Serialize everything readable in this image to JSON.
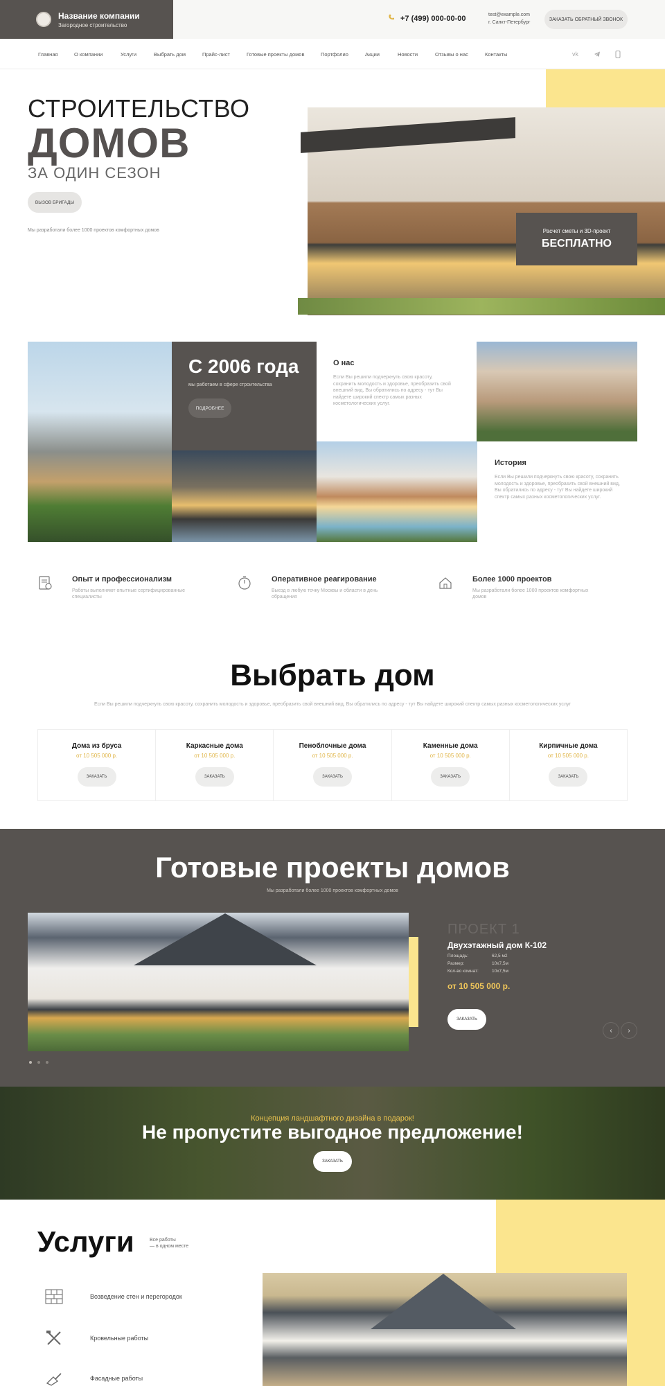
{
  "header": {
    "company_name": "Название компании",
    "company_sub": "Загородное строительство",
    "phone": "+7 (499) 000-00-00",
    "email": "test@example.com",
    "city": "г. Санкт-Петербург",
    "callback": "ЗАКАЗАТЬ ОБРАТНЫЙ ЗВОНОК"
  },
  "nav": {
    "items": [
      "Главная",
      "О компании",
      "Услуги",
      "Выбрать дом",
      "Прайс-лист",
      "Готовые проекты домов",
      "Портфолио",
      "Акции",
      "Новости",
      "Отзывы о нас",
      "Контакты"
    ],
    "social": [
      "vk-icon",
      "telegram-icon",
      "whatsapp-icon"
    ]
  },
  "hero": {
    "title1": "СТРОИТЕЛЬСТВО",
    "title2": "ДОМОВ",
    "title3": "ЗА ОДИН СЕЗОН",
    "button": "ВЫЗОВ БРИГАДЫ",
    "subtitle": "Мы разработали более 1000 проектов комфортных домов",
    "promo_line1": "Расчет сметы и 3D-проект",
    "promo_line2": "БЕСПЛАТНО"
  },
  "about": {
    "since_title": "С 2006 года",
    "since_sub": "мы работаем в сфере строительства",
    "since_button": "ПОДРОБНЕЕ",
    "block1_title": "О нас",
    "block1_text": "Если Вы решили подчеркнуть свою красоту, сохранить молодость и здоровье, преобразить свой внешний вид, Вы обратились по адресу - тут Вы найдете широкий спектр самых разных косметологических услуг.",
    "block2_title": "История",
    "block2_text": "Если Вы решили подчеркнуть свою красоту, сохранить молодость и здоровье, преобразить свой внешний вид, Вы обратились по адресу - тут Вы найдете широкий спектр самых разных косметологических услуг."
  },
  "features": [
    {
      "icon": "document-check-icon",
      "title": "Опыт и профессионализм",
      "text": "Работы выполняют опытные сертифицированные специалисты"
    },
    {
      "icon": "stopwatch-icon",
      "title": "Оперативное реагирование",
      "text": "Выезд в любую точку Москвы и области в день обращения"
    },
    {
      "icon": "house-plan-icon",
      "title": "Более 1000 проектов",
      "text": "Мы разработали более 1000 проектов комфортных домов"
    }
  ],
  "choose": {
    "title": "Выбрать дом",
    "subtitle": "Если Вы решили подчеркнуть свою красоту, сохранить молодость и здоровье, преобразить свой внешний вид, Вы обратились по адресу - тут Вы найдете широкий спектр самых разных косметологических услуг",
    "cards": [
      {
        "name": "Дома из бруса",
        "price": "от 10 505 000 р.",
        "button": "ЗАКАЗАТЬ"
      },
      {
        "name": "Каркасные дома",
        "price": "от 10 505 000 р.",
        "button": "ЗАКАЗАТЬ"
      },
      {
        "name": "Пеноблочные дома",
        "price": "от 10 505 000 р.",
        "button": "ЗАКАЗАТЬ"
      },
      {
        "name": "Каменные дома",
        "price": "от 10 505 000 р.",
        "button": "ЗАКАЗАТЬ"
      },
      {
        "name": "Кирпичные дома",
        "price": "от 10 505 000 р.",
        "button": "ЗАКАЗАТЬ"
      }
    ]
  },
  "projects": {
    "title": "Готовые проекты домов",
    "subtitle": "Мы разработали более 1000 проектов комфортных домов",
    "number": "ПРОЕКТ 1",
    "name": "Двухэтажный дом К-102",
    "specs": [
      {
        "label": "Площадь:",
        "value": "62,5 м2"
      },
      {
        "label": "Размер:",
        "value": "10х7,5м"
      },
      {
        "label": "Кол-во комнат:",
        "value": "10х7,5м"
      }
    ],
    "price": "от 10 505 000 р.",
    "button": "ЗАКАЗАТЬ",
    "prev": "‹",
    "next": "›"
  },
  "offer": {
    "kicker": "Концепция ландшафтного дизайна в подарок!",
    "title": "Не пропустите выгодное предложение!",
    "button": "ЗАКАЗАТЬ"
  },
  "services": {
    "title": "Услуги",
    "subtitle_line1": "Все работы",
    "subtitle_line2": "— в одном месте",
    "items": [
      {
        "icon": "brick-wall-icon",
        "label": "Возведение стен и перегородок"
      },
      {
        "icon": "roofing-tools-icon",
        "label": "Кровельные работы"
      },
      {
        "icon": "trowel-icon",
        "label": "Фасадные работы"
      }
    ]
  },
  "colors": {
    "dark": "#575350",
    "yellow": "#fbe58e",
    "accent": "#e0b547"
  }
}
